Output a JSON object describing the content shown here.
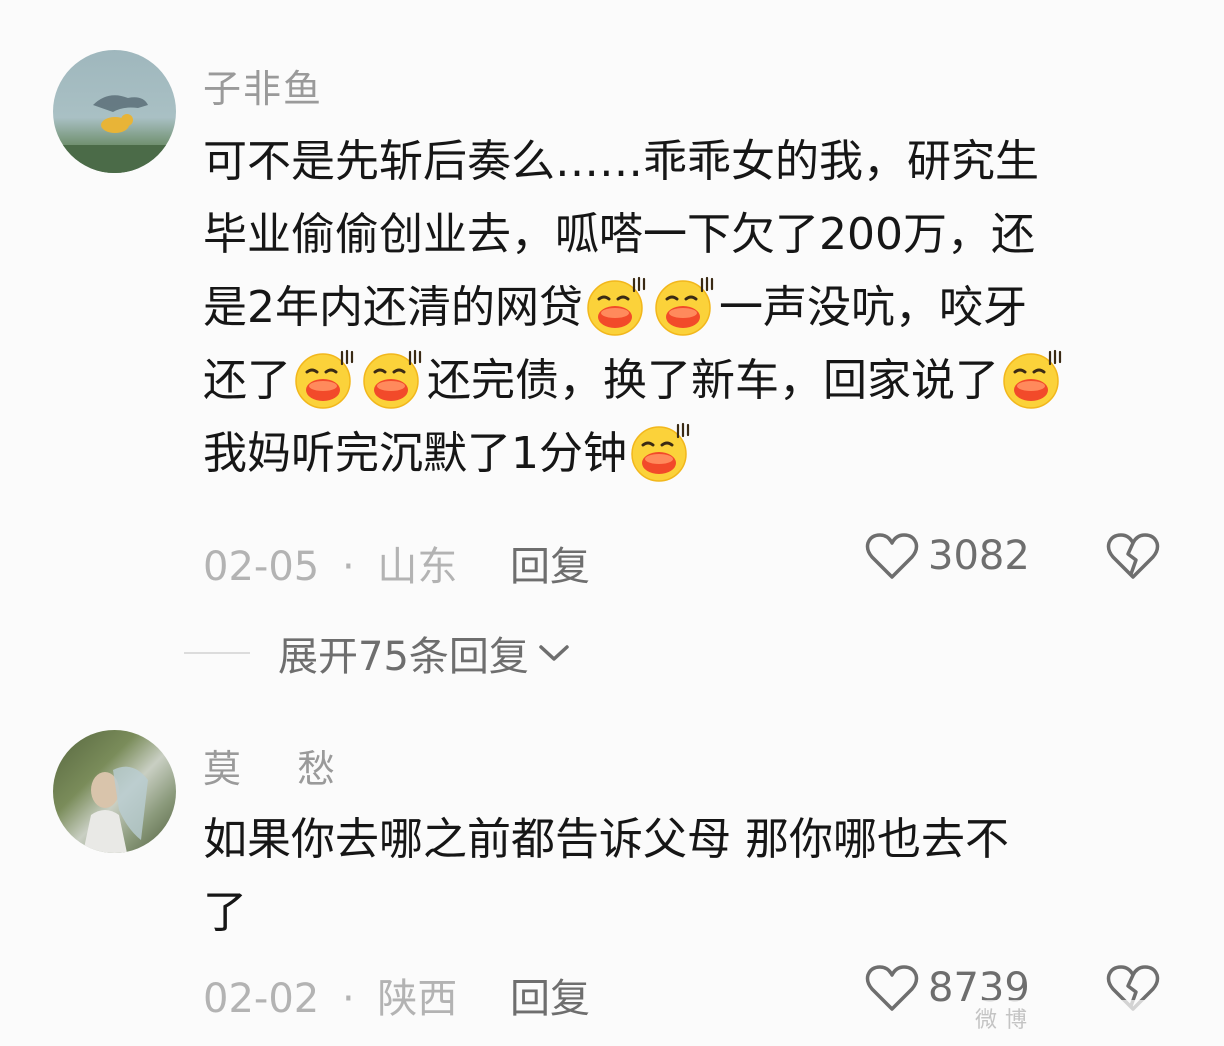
{
  "comments": [
    {
      "username": "子非鱼",
      "content_lines": [
        [
          "可不是先斩后奏么……乖乖女的我，研究生"
        ],
        [
          "毕业偷偷创业去，呱嗒一下欠了200万，还"
        ],
        [
          "是2年内还清的网贷",
          "{emoji}",
          "{emoji}",
          "一声没吭，咬牙"
        ],
        [
          "还了",
          "{emoji}",
          "{emoji}",
          "还完债，换了新车，回家说了",
          "{emoji}"
        ],
        [
          "我妈听完沉默了1分钟",
          "{emoji}"
        ]
      ],
      "date": "02-05",
      "location": "山东",
      "separator": "·",
      "reply_label": "回复",
      "likes": "3082",
      "expand_label": "展开75条回复"
    },
    {
      "username": "莫　 愁",
      "content_lines": [
        [
          "如果你去哪之前都告诉父母  那你哪也去不"
        ],
        [
          "了"
        ]
      ],
      "date": "02-02",
      "location": "陕西",
      "separator": "·",
      "reply_label": "回复",
      "likes": "8739"
    }
  ],
  "icons": {
    "emoji": "grinning-face-emoji-icon",
    "like": "heart-outline-icon",
    "dislike": "broken-heart-icon",
    "expand": "chevron-down-icon"
  },
  "watermark": "微博"
}
